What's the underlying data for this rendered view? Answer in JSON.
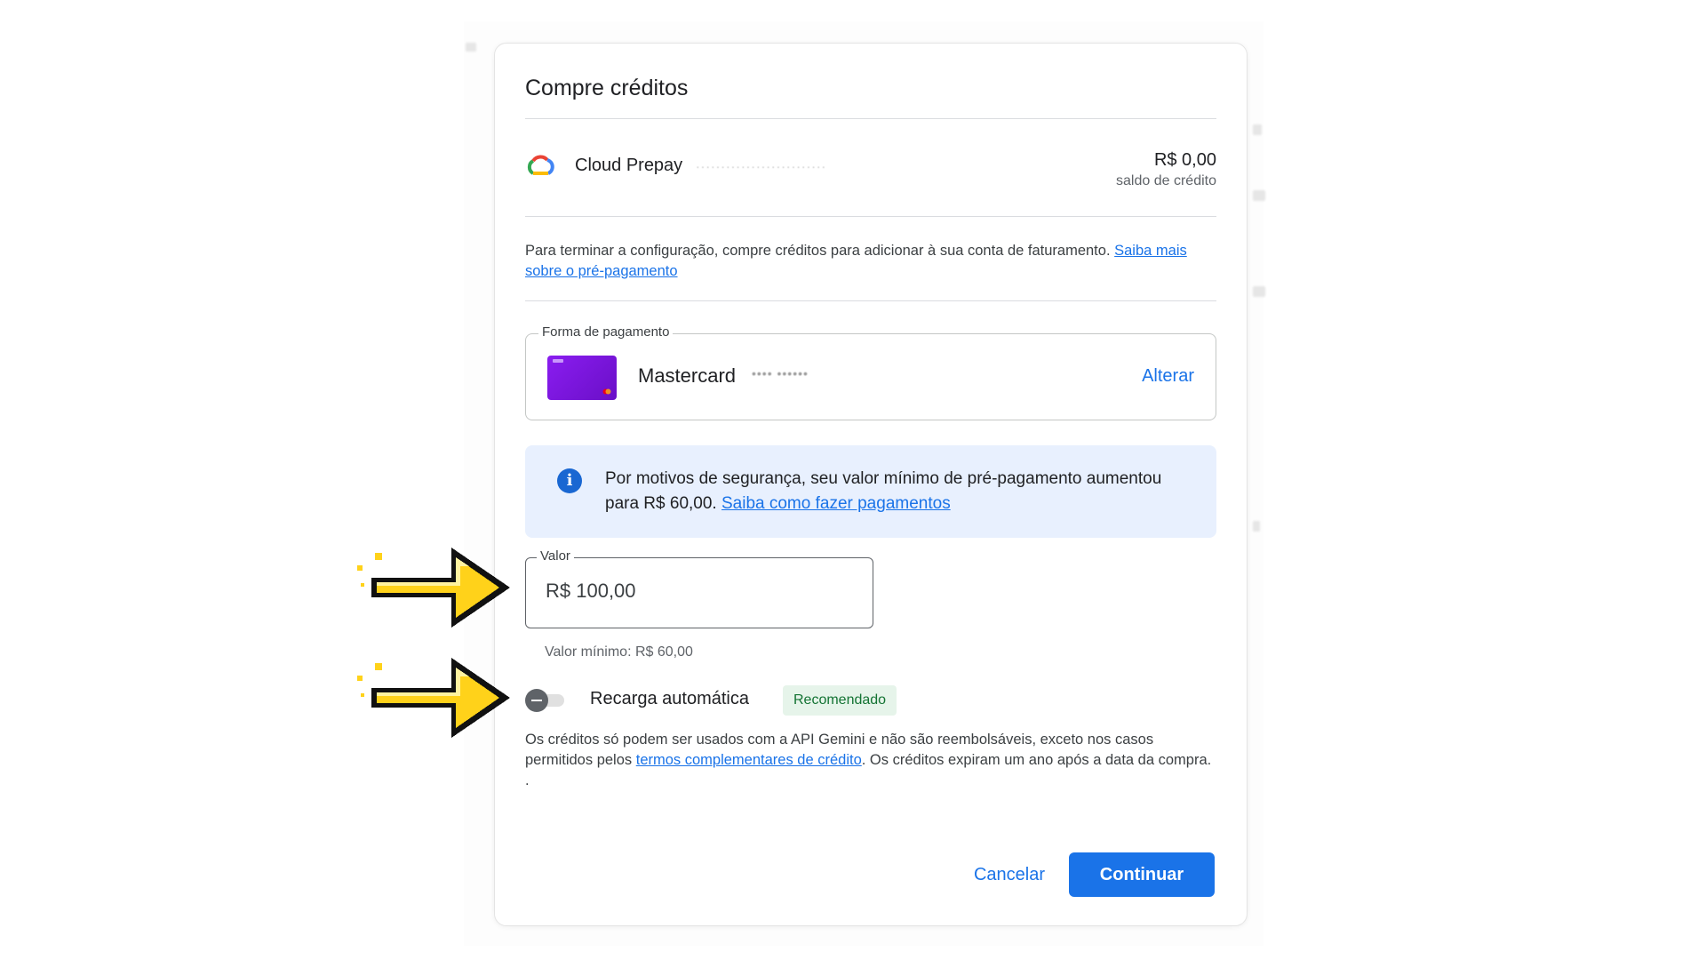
{
  "dialog": {
    "title": "Compre créditos",
    "account": {
      "name": "Cloud Prepay",
      "masked_id": "··························",
      "balance": "R$ 0,00",
      "balance_label": "saldo de crédito"
    },
    "intro": {
      "text": "Para terminar a configuração, compre créditos para adicionar à sua conta de faturamento. ",
      "link": "Saiba mais sobre o pré-pagamento"
    },
    "payment_method": {
      "label": "Forma de pagamento",
      "card_name": "Mastercard",
      "card_mask": "•••• ••••••",
      "change_label": "Alterar"
    },
    "info": {
      "text": "Por motivos de segurança, seu valor mínimo de pré-pagamento aumentou para R$ 60,00. ",
      "link": "Saiba como fazer pagamentos"
    },
    "amount": {
      "label": "Valor",
      "value": "R$ 100,00",
      "hint": "Valor mínimo: R$ 60,00"
    },
    "auto_recharge": {
      "label": "Recarga automática",
      "badge": "Recomendado",
      "enabled": false
    },
    "disclaimer": {
      "text_before": "Os créditos só podem ser usados com a API Gemini e não são reembolsáveis, exceto nos casos permitidos pelos ",
      "link": "termos complementares de crédito",
      "text_after": ". Os créditos expiram um ano após a data da compra. ."
    },
    "buttons": {
      "cancel": "Cancelar",
      "continue": "Continuar"
    }
  },
  "colors": {
    "accent": "#1a73e8",
    "info_background": "#e8f0fe",
    "badge_background": "#e6f4ea",
    "badge_text": "#137333",
    "card": "#7b16e0",
    "arrow": "#ffd21a"
  },
  "icons": [
    "google-cloud-icon",
    "info-icon",
    "mastercard-icon",
    "toggle-icon",
    "pointer-arrow-icon"
  ]
}
